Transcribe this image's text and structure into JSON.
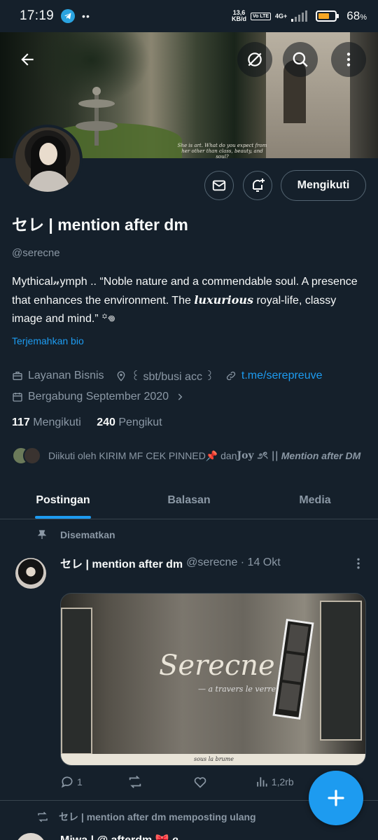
{
  "status_bar": {
    "time": "17:19",
    "dots": "••",
    "speed_value": "13,6",
    "speed_unit": "KB/d",
    "volte": "Vo LTE",
    "network": "4G+",
    "battery_pct": "68",
    "battery_unit": "%",
    "battery_level": 0.68,
    "battery_color": "#f5a623"
  },
  "banner": {
    "quote": "She is art. What do you expect from her other than class, beauty, and soul?"
  },
  "toolbar": {
    "back_icon": "arrow-left-icon",
    "hide_icon": "eye-slash-icon",
    "search_icon": "search-icon",
    "more_icon": "more-vertical-icon"
  },
  "profile": {
    "display_name": "セレ | mention after dm",
    "handle": "@serecne",
    "bio_part1": "Mythical𝓃ymph .. “Noble nature and a commendable soul. A presence that enhances the environment. The ",
    "bio_lux": "luxurious",
    "bio_part2": " royal-life, classy image and mind.” ꙳𖦹",
    "translate_label": "Terjemahkan bio",
    "category": "Layanan Bisnis",
    "location": "꒰ sbt/busi acc ꒱",
    "link": "t.me/serepreuve",
    "joined": "Bergabung September 2020",
    "following_count": "117",
    "following_label": "Mengikuti",
    "followers_count": "240",
    "followers_label": "Pengikut",
    "followed_by_prefix": "Diikuti oleh KIRIM MF CEK PINNED📌 dan ",
    "followed_by_name": "𝐉𝐨𝐲 ೨ৎ ||",
    "followed_by_italic": "Mention after DM"
  },
  "actions": {
    "follow_label": "Mengikuti"
  },
  "tabs": [
    {
      "label": "Postingan",
      "active": true
    },
    {
      "label": "Balasan",
      "active": false
    },
    {
      "label": "Media",
      "active": false
    }
  ],
  "pinned_post": {
    "pinned_label": "Disematkan",
    "author": "セレ | mention after dm",
    "handle_time": "@serecne · 14 Okt",
    "media_title": "Serecne",
    "media_subtitle": "— a travers le verre",
    "media_caption": "sous la brume",
    "replies": "1",
    "views": "1,2rb"
  },
  "repost": {
    "label": "セレ | mention after dm memposting ulang",
    "next_author": "Miwa | @ afterdm 🎀 ɞ"
  },
  "colors": {
    "background": "#15202b",
    "accent": "#1d9bf0",
    "muted": "#8b98a5",
    "border": "#38444d"
  }
}
